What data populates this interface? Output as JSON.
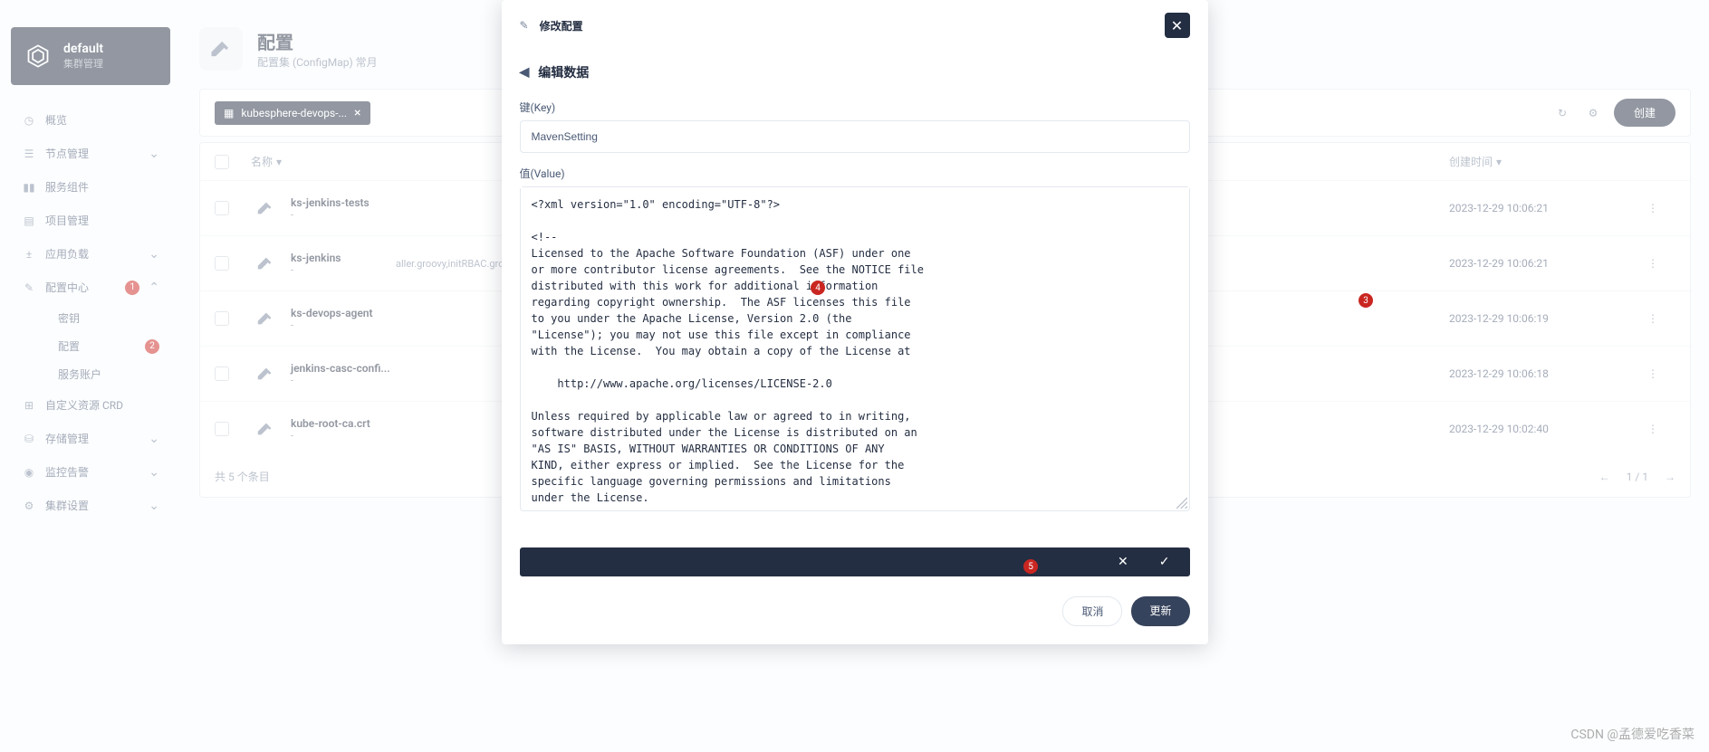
{
  "cluster": {
    "name": "default",
    "sub": "集群管理"
  },
  "nav": {
    "overview": "概览",
    "nodes": "节点管理",
    "components": "服务组件",
    "projects": "项目管理",
    "workloads": "应用负载",
    "config": "配置中心",
    "secret": "密钥",
    "configmap": "配置",
    "serviceaccount": "服务账户",
    "crd": "自定义资源 CRD",
    "storage": "存储管理",
    "monitoring": "监控告警",
    "clustersettings": "集群设置"
  },
  "badges": {
    "config": "1",
    "configmap": "2"
  },
  "page": {
    "title": "配置",
    "desc": "配置集 (ConfigMap) 常月"
  },
  "filter_tag": "kubesphere-devops-...",
  "buttons": {
    "create": "创建",
    "cancel": "取消",
    "update": "更新"
  },
  "table": {
    "col_name": "名称",
    "col_time": "创建时间",
    "footer": "共 5 个条目",
    "page_info": "1 / 1",
    "rows": [
      {
        "name": "ks-jenkins-tests",
        "sub": "-",
        "mid": "",
        "time": "2023-12-29 10:06:21"
      },
      {
        "name": "ks-jenkins",
        "sub": "-",
        "mid": "aller.groovy,initRBAC.groovy,initSona ... ionConfiguration.xml",
        "time": "2023-12-29 10:06:21"
      },
      {
        "name": "ks-devops-agent",
        "sub": "-",
        "mid": "",
        "time": "2023-12-29 10:06:19"
      },
      {
        "name": "jenkins-casc-confi...",
        "sub": "-",
        "mid": "",
        "time": "2023-12-29 10:06:18"
      },
      {
        "name": "kube-root-ca.crt",
        "sub": "-",
        "mid": "",
        "time": "2023-12-29 10:02:40"
      }
    ]
  },
  "modal": {
    "title": "修改配置",
    "subtitle": "编辑数据",
    "key_label": "键(Key)",
    "key_value": "MavenSetting",
    "value_label": "值(Value)",
    "value_text": "<?xml version=\"1.0\" encoding=\"UTF-8\"?>\n\n<!--\nLicensed to the Apache Software Foundation (ASF) under one\nor more contributor license agreements.  See the NOTICE file\ndistributed with this work for additional information\nregarding copyright ownership.  The ASF licenses this file\nto you under the Apache License, Version 2.0 (the\n\"License\"); you may not use this file except in compliance\nwith the License.  You may obtain a copy of the License at\n\n    http://www.apache.org/licenses/LICENSE-2.0\n\nUnless required by applicable law or agreed to in writing,\nsoftware distributed under the License is distributed on an\n\"AS IS\" BASIS, WITHOUT WARRANTIES OR CONDITIONS OF ANY\nKIND, either express or implied.  See the License for the\nspecific language governing permissions and limitations\nunder the License.\n-->"
  },
  "annotations": {
    "a3": "3",
    "a4": "4",
    "a5": "5"
  },
  "watermark": "CSDN @孟德爱吃香菜"
}
